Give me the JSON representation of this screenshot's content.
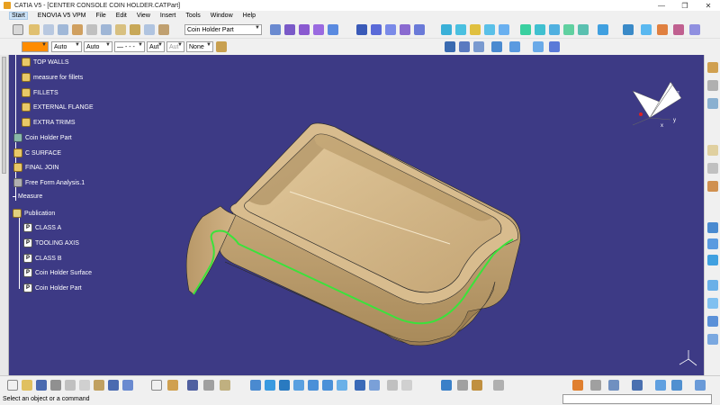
{
  "window": {
    "title": "CATIA V5 - [CENTER CONSOLE COIN HOLDER.CATPart]",
    "controls": [
      "—",
      "❐",
      "✕"
    ]
  },
  "menu": {
    "items": [
      "Start",
      "ENOVIA V5 VPM",
      "File",
      "Edit",
      "View",
      "Insert",
      "Tools",
      "Window",
      "Help"
    ]
  },
  "toolbar": {
    "part_combo": "Coin Holder Part",
    "color_combo": "",
    "transparency_combo": "Auto",
    "thickness_combo": "Auto",
    "linetype_combo": "— - - -",
    "point_combo": "Aut",
    "layer_combo": "Aut",
    "none_combo": "None"
  },
  "tree": {
    "nodes": [
      {
        "label": "TOP WALLS",
        "icon": "geometrical-set-icon"
      },
      {
        "label": "measure for fillets",
        "icon": "geometrical-set-icon"
      },
      {
        "label": "FILLETS",
        "icon": "geometrical-set-icon"
      },
      {
        "label": "EXTERNAL FLANGE",
        "icon": "geometrical-set-icon"
      },
      {
        "label": "EXTRA TRIMS",
        "icon": "geometrical-set-icon"
      },
      {
        "label": "Coin Holder Part",
        "icon": "body-icon"
      },
      {
        "label": "C SURFACE",
        "icon": "geometrical-set-icon"
      },
      {
        "label": "FINAL JOIN",
        "icon": "geometrical-set-icon"
      },
      {
        "label": "Free Form Analysis.1",
        "icon": "analysis-icon"
      },
      {
        "label": "Measure",
        "icon": "measure-icon"
      },
      {
        "label": "Publication",
        "icon": "publication-icon"
      },
      {
        "label": "CLASS A",
        "icon": "published-element-icon"
      },
      {
        "label": "TOOLING AXIS",
        "icon": "published-element-icon"
      },
      {
        "label": "CLASS B",
        "icon": "published-element-icon"
      },
      {
        "label": "Coin Holder Surface",
        "icon": "published-element-icon"
      },
      {
        "label": "Coin Holder Part",
        "icon": "published-element-icon"
      }
    ]
  },
  "compass": {
    "axis_x": "x",
    "axis_y": "y",
    "axis_z": "z"
  },
  "status": {
    "message": "Select an object or a command"
  },
  "colors": {
    "viewport_bg": "#3d3a85",
    "part_color": "#c6a778",
    "highlight_edge": "#3be23b"
  }
}
